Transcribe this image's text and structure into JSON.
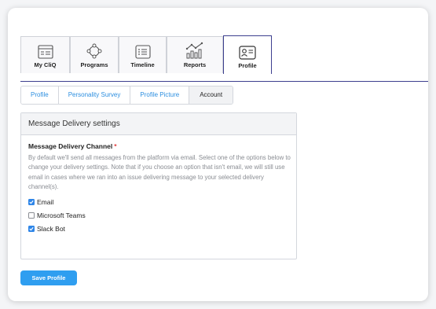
{
  "top_tabs": [
    {
      "label": "My CliQ",
      "icon": "id-card-icon"
    },
    {
      "label": "Programs",
      "icon": "network-icon"
    },
    {
      "label": "Timeline",
      "icon": "list-icon"
    },
    {
      "label": "Reports",
      "icon": "chart-icon"
    },
    {
      "label": "Profile",
      "icon": "profile-card-icon",
      "active": true
    }
  ],
  "sub_tabs": [
    {
      "label": "Profile"
    },
    {
      "label": "Personality Survey"
    },
    {
      "label": "Profile Picture"
    },
    {
      "label": "Account",
      "active": true
    }
  ],
  "panel": {
    "title": "Message Delivery settings",
    "field_label": "Message Delivery Channel",
    "required_mark": "*",
    "help_text": "By default we'll send all messages from the platform via email. Select one of the options below to change your delivery settings. Note that if you choose an option that isn't email, we will still use email in cases where we ran into an issue delivering message to your selected delivery channel(s).",
    "options": [
      {
        "label": "Email",
        "checked": true
      },
      {
        "label": "Microsoft Teams",
        "checked": false
      },
      {
        "label": "Slack Bot",
        "checked": true
      }
    ]
  },
  "save_label": "Save Profile",
  "colors": {
    "accent": "#2f9ef0",
    "active_tab_border": "#3d3f8f",
    "link": "#2d8fe0"
  }
}
